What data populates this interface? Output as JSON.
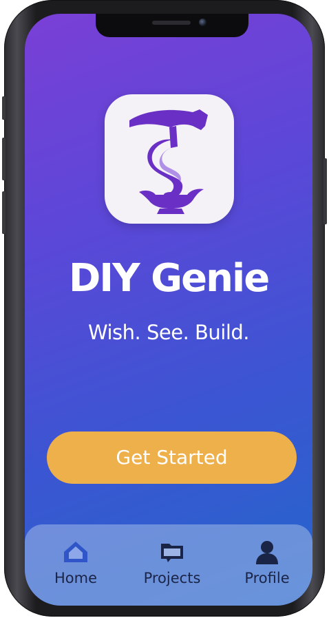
{
  "app": {
    "title": "DIY Genie",
    "tagline": "Wish. See. Build.",
    "icon": "hammer-genie-lamp-icon"
  },
  "cta": {
    "label": "Get Started",
    "color": "#eeb04a"
  },
  "tabbar": {
    "items": [
      {
        "label": "Home",
        "icon": "home-icon",
        "active": true
      },
      {
        "label": "Projects",
        "icon": "folder-icon",
        "active": false
      },
      {
        "label": "Profile",
        "icon": "person-icon",
        "active": false
      }
    ]
  },
  "colors": {
    "gradient_top": "#7a3fd6",
    "gradient_bottom": "#2466cc",
    "brand_purple": "#6a2fc4",
    "tab_icon_active": "#2f55c8",
    "tab_icon": "#1a2446"
  }
}
